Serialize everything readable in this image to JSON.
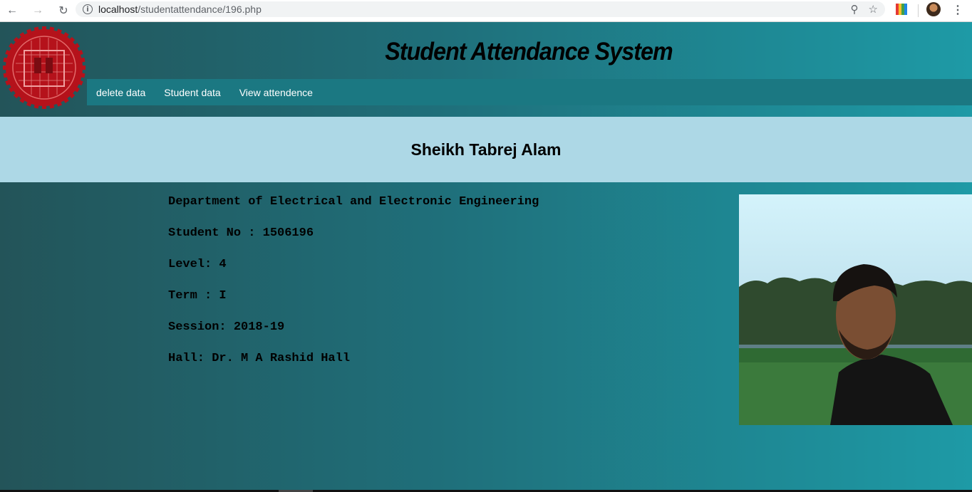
{
  "browser": {
    "url_host": "localhost",
    "url_path": "/studentattendance/196.php"
  },
  "site": {
    "title": "Student Attendance System",
    "nav": [
      "delete data",
      "Student data",
      "View attendence"
    ]
  },
  "student": {
    "name": "Sheikh Tabrej Alam",
    "department": "Department of Electrical and Electronic Engineering",
    "student_no": "Student No : 1506196",
    "level": "Level: 4",
    "term": "Term : I",
    "session": "Session: 2018-19",
    "hall": "Hall: Dr. M A Rashid Hall"
  },
  "icons": {
    "back": "back-arrow-icon",
    "forward": "forward-arrow-icon",
    "reload": "reload-icon",
    "info": "info-icon",
    "zoom": "zoom-icon",
    "bookmark": "star-icon",
    "menu": "kebab-menu-icon"
  },
  "colors": {
    "name_band": "#add8e6",
    "navbar": "#1b7882",
    "logo_red": "#b5121b"
  }
}
